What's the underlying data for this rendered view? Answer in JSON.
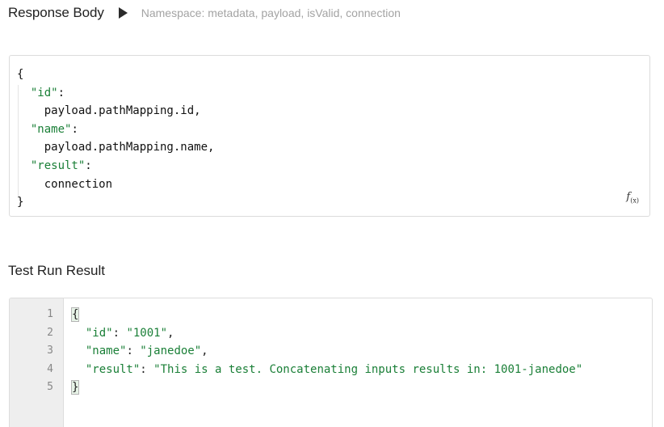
{
  "response_body": {
    "title": "Response Body",
    "namespace_hint": "Namespace: metadata, payload, isValid, connection",
    "code": {
      "open": "{",
      "entries": [
        {
          "key": "\"id\"",
          "value": "payload.pathMapping.id,"
        },
        {
          "key": "\"name\"",
          "value": "payload.pathMapping.name,"
        },
        {
          "key": "\"result\"",
          "value": "connection"
        }
      ],
      "close": "}"
    },
    "fx_label": "f",
    "fx_sub": "(x)"
  },
  "test_run": {
    "title": "Test Run Result",
    "line_numbers": [
      "1",
      "2",
      "3",
      "4",
      "5"
    ],
    "lines": {
      "l1": "{",
      "l2_key": "\"id\"",
      "l2_val": "\"1001\"",
      "l3_key": "\"name\"",
      "l3_val": "\"janedoe\"",
      "l4_key": "\"result\"",
      "l4_val": "\"This is a test. Concatenating inputs results in: 1001-janedoe\"",
      "l5": "}"
    }
  }
}
